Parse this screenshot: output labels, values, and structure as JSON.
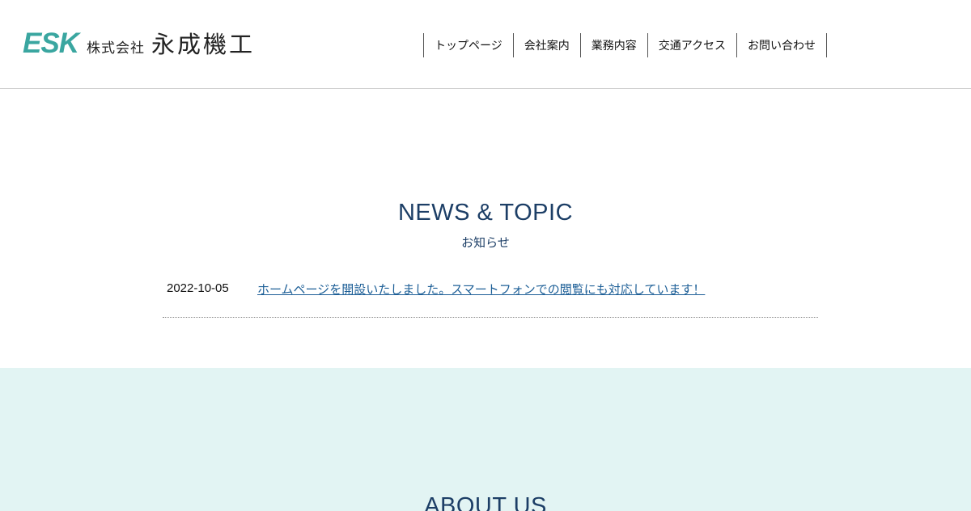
{
  "header": {
    "logo": {
      "mark": "ESK",
      "prefix": "株式会社",
      "name": "永成機工"
    },
    "nav": [
      {
        "label": "トップページ"
      },
      {
        "label": "会社案内"
      },
      {
        "label": "業務内容"
      },
      {
        "label": "交通アクセス"
      },
      {
        "label": "お問い合わせ"
      }
    ]
  },
  "news": {
    "title": "NEWS & TOPIC",
    "subtitle": "お知らせ",
    "items": [
      {
        "date": "2022-10-05",
        "text": "ホームページを開設いたしました。スマートフォンでの閲覧にも対応しています！"
      }
    ]
  },
  "about": {
    "title": "ABOUT US"
  },
  "colors": {
    "brand": "#3aa6a0",
    "heading": "#1c3e66",
    "link": "#1d5f97",
    "about_bg": "#e2f4f3"
  }
}
